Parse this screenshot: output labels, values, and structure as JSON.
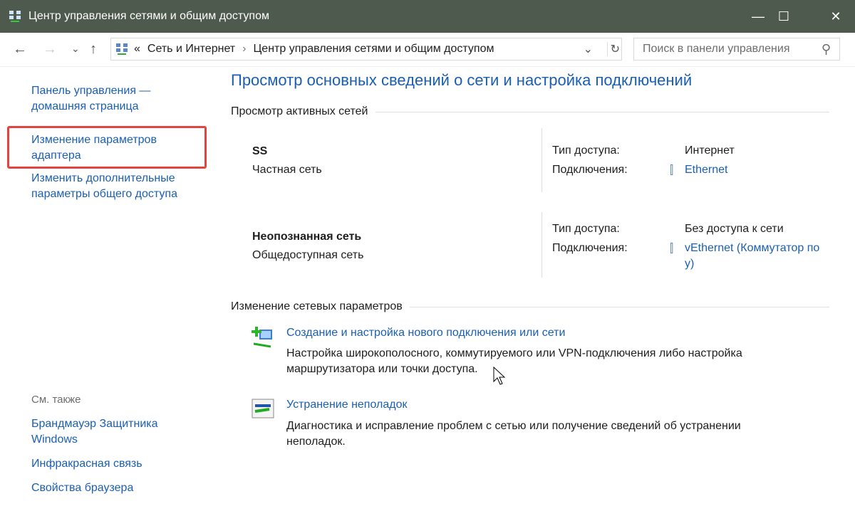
{
  "window": {
    "title": "Центр управления сетями и общим доступом",
    "minimize": "—",
    "maximize": "☐",
    "close": "✕"
  },
  "nav": {
    "back": "←",
    "forward": "→",
    "recent": "⌄",
    "up": "↑",
    "breadcrumb_prefix": "«",
    "breadcrumb": [
      "Сеть и Интернет",
      "Центр управления сетями и общим доступом"
    ],
    "separator": "›",
    "dropdown": "⌄",
    "refresh": "↻",
    "search_placeholder": "Поиск в панели управления",
    "search_icon": "⚲"
  },
  "sidebar": {
    "home": "Панель управления — домашняя страница",
    "adapter": "Изменение параметров адаптера",
    "sharing": "Изменить дополнительные параметры общего доступа",
    "see_also": "См. также",
    "links": [
      "Брандмауэр Защитника Windows",
      "Инфракрасная связь",
      "Свойства браузера"
    ]
  },
  "main": {
    "title": "Просмотр основных сведений о сети и настройка подключений",
    "active_header": "Просмотр активных сетей",
    "networks": [
      {
        "name": "SS",
        "type": "Частная сеть",
        "access_label": "Тип доступа:",
        "access": "Интернет",
        "conn_label": "Подключения:",
        "conn": "Ethernet"
      },
      {
        "name": "Неопознанная сеть",
        "type": "Общедоступная сеть",
        "access_label": "Тип доступа:",
        "access": "Без доступа к сети",
        "conn_label": "Подключения:",
        "conn": "vEthernet (Коммутатор по у)"
      }
    ],
    "change_header": "Изменение сетевых параметров",
    "tasks": [
      {
        "link": "Создание и настройка нового подключения или сети",
        "desc": "Настройка широкополосного, коммутируемого или VPN-подключения либо настройка маршрутизатора или точки доступа."
      },
      {
        "link": "Устранение неполадок",
        "desc": "Диагностика и исправление проблем с сетью или получение сведений об устранении неполадок."
      }
    ]
  }
}
